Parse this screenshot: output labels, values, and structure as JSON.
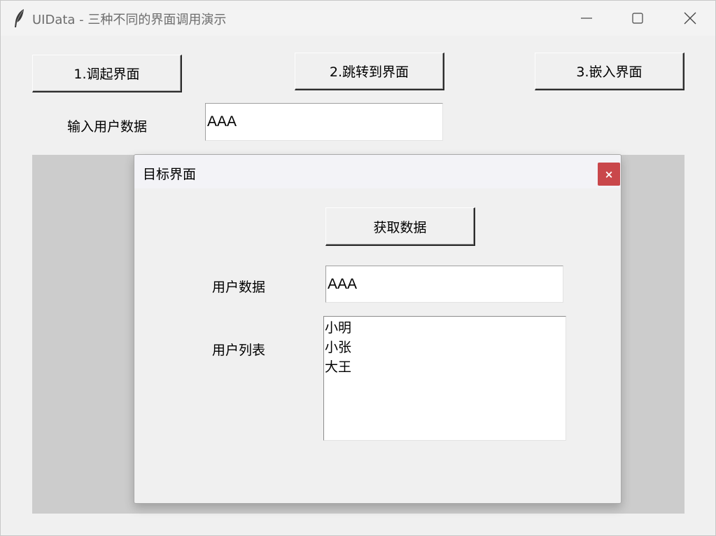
{
  "window": {
    "title": "UIData - 三种不同的界面调用演示",
    "icon": "feather-icon"
  },
  "toolbar": {
    "btn_invoke": "1.调起界面",
    "btn_jump": "2.跳转到界面",
    "btn_embed": "3.嵌入界面"
  },
  "input_row": {
    "label": "输入用户数据",
    "value": "AAA"
  },
  "dialog": {
    "title": "目标界面",
    "close_label": "×",
    "get_button": "获取数据",
    "user_data_label": "用户数据",
    "user_data_value": "AAA",
    "user_list_label": "用户列表",
    "user_list": [
      "小明",
      "小张",
      "大王"
    ]
  },
  "colors": {
    "embed_background": "#cccccc",
    "dialog_close": "#c9474b"
  }
}
